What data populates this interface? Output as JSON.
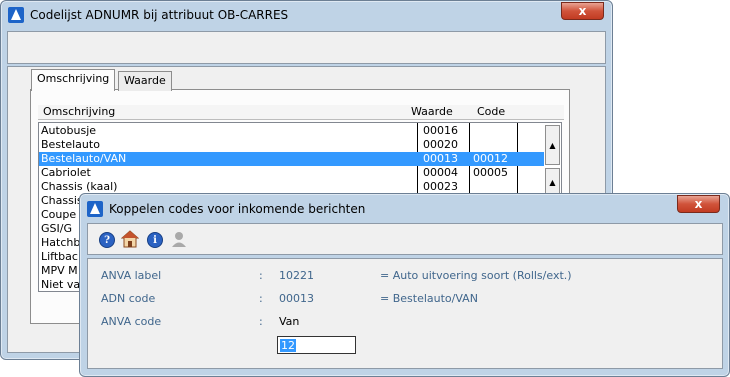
{
  "back_window": {
    "title": "Codelijst ADNUMR bij attribuut OB-CARRES",
    "close_label": "x",
    "tabs": [
      {
        "label": "Omschrijving",
        "active": true
      },
      {
        "label": "Waarde",
        "active": false
      }
    ],
    "list": {
      "headers": {
        "omschrijving": "Omschrijving",
        "waarde": "Waarde",
        "code": "Code"
      },
      "rows": [
        {
          "omschrijving": "Autobusje",
          "waarde": "00016",
          "code": "",
          "selected": false
        },
        {
          "omschrijving": "Bestelauto",
          "waarde": "00020",
          "code": "",
          "selected": false
        },
        {
          "omschrijving": "Bestelauto/VAN",
          "waarde": "00013",
          "code": "00012",
          "selected": true
        },
        {
          "omschrijving": "Cabriolet",
          "waarde": "00004",
          "code": "00005",
          "selected": false
        },
        {
          "omschrijving": "Chassis (kaal)",
          "waarde": "00023",
          "code": "",
          "selected": false
        },
        {
          "omschrijving": "Chassis",
          "waarde": "",
          "code": "",
          "selected": false
        },
        {
          "omschrijving": "Coupe",
          "waarde": "",
          "code": "",
          "selected": false
        },
        {
          "omschrijving": "GSI/G",
          "waarde": "",
          "code": "",
          "selected": false
        },
        {
          "omschrijving": "Hatchb",
          "waarde": "",
          "code": "",
          "selected": false
        },
        {
          "omschrijving": "Liftbac",
          "waarde": "",
          "code": "",
          "selected": false
        },
        {
          "omschrijving": "MPV M",
          "waarde": "",
          "code": "",
          "selected": false
        },
        {
          "omschrijving": "Niet va",
          "waarde": "",
          "code": "",
          "selected": false
        }
      ]
    }
  },
  "front_window": {
    "title": "Koppelen codes voor inkomende berichten",
    "close_label": "x",
    "toolbar_icons": [
      "help-icon",
      "home-icon",
      "info-icon",
      "user-icon"
    ],
    "fields": [
      {
        "label": "ANVA label",
        "sep": ":",
        "value": "10221",
        "eq": "= Auto uitvoering soort (Rolls/ext.)"
      },
      {
        "label": "ADN code",
        "sep": ":",
        "value": "00013",
        "eq": "= Bestelauto/VAN"
      },
      {
        "label": "ANVA code",
        "sep": ":",
        "value": "Van",
        "eq": ""
      }
    ],
    "input_value": "12"
  },
  "colors": {
    "selection": "#3399ff",
    "label_blue": "#40668c",
    "close_red": "#c23b22",
    "frame": "#bfd3e6"
  }
}
